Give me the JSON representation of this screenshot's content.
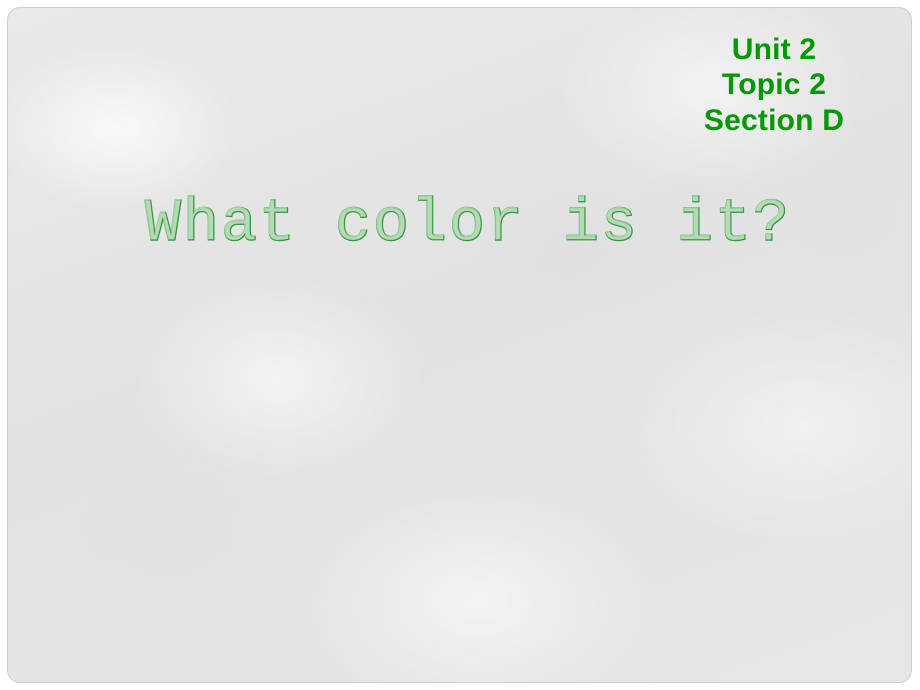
{
  "slide": {
    "background_color": "#e4e4e4",
    "border_color": "#cfcfcf",
    "accent_color": "#009900",
    "outline_color": "#2e9c35"
  },
  "corner_heading": {
    "lines": [
      {
        "text": "Unit 2"
      },
      {
        "text": "Topic 2"
      },
      {
        "text": "Section D"
      }
    ]
  },
  "title": {
    "text": "What color is it?"
  }
}
